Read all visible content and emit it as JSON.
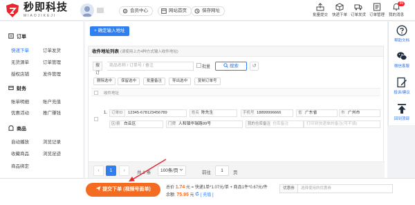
{
  "header": {
    "brand_title": "秒即科技",
    "brand_subtitle": "MIAOJIKEJI",
    "nav": [
      "会员中心",
      "网站首页",
      "保存网址"
    ],
    "icons": [
      {
        "label": "批量提交",
        "icon": "upload-icon"
      },
      {
        "label": "快递下单",
        "icon": "package-icon"
      },
      {
        "label": "订单发货",
        "icon": "truck-icon"
      },
      {
        "label": "订单管理",
        "icon": "list-icon"
      },
      {
        "label": "我的消息",
        "icon": "bell-icon",
        "badge": "99"
      }
    ]
  },
  "sidebar": {
    "groups": [
      {
        "title": "订单",
        "icon": "order-icon",
        "items": [
          "快递下单",
          "订单发货",
          "无货源单",
          "订单管理",
          "授权店铺",
          "发件管理"
        ]
      },
      {
        "title": "财务",
        "icon": "finance-icon",
        "items": [
          "账单明细",
          "账户充值",
          "优惠活动",
          "推广赚钱"
        ]
      },
      {
        "title": "商品",
        "icon": "goods-icon",
        "items": [
          "自动播放",
          "浏览记录",
          "收藏商品",
          "浏览足迹",
          "商品绑定"
        ]
      }
    ],
    "active": "快递下单"
  },
  "content": {
    "confirm_button": "+ 确定输入地址",
    "list_title": "收件地址列表",
    "list_hint": "(请使用上方4种方式输入收件地址)",
    "search": {
      "label": "搜订单",
      "placeholder": "商品名称 / 订单号 / 备注",
      "checkbox_label": "批量",
      "button": "搜索",
      "reset": "↺"
    },
    "actions": [
      "删除选中",
      "保留选中",
      "批量备注",
      "导出选中",
      "复制订单号"
    ],
    "table_header": "收件地址",
    "row": {
      "index": "1.",
      "order_label": "订单ID",
      "order_value": "12345-678123456789",
      "name_label": "姓名",
      "name_value": "陈先生",
      "phone_label": "手机号",
      "phone_value": "18899996666",
      "province_label": "省",
      "province_value": "广东省",
      "city_label": "市",
      "city_value": "广州市",
      "district_label": "区/县",
      "district_value": "白云区",
      "street_label": "门牌",
      "street_value": "人和镇华瑞路99号",
      "remark_label": "我的仓库备注",
      "remark_placeholder": "仓库备注",
      "print_placeholder": "打印到快递单的备注(可不填)"
    },
    "pagination": {
      "prev": "‹",
      "current": "1",
      "next": "›",
      "total": "共 1 条",
      "page_size": "100条/页",
      "goto_label": "前往",
      "goto_value": "1",
      "page_unit": "页"
    }
  },
  "right_bar": [
    {
      "label": "帮助文档",
      "icon": "help-icon"
    },
    {
      "label": "微信客服",
      "icon": "wechat-icon"
    },
    {
      "label": "投诉/建议",
      "icon": "feedback-icon"
    },
    {
      "label": "回到顶部",
      "icon": "top-icon"
    }
  ],
  "bottom": {
    "submit": "提交下单 (视频号面单)",
    "total_label": "总价",
    "total_value": "1.74",
    "total_detail": "元 = 快递1单*1.07元/单 + 商品1件*0.67元/件",
    "balance_label": "余额:",
    "balance_value": "75.95",
    "balance_unit": "元",
    "recharge": "[ 充值 ]",
    "coupon_label": "优惠券",
    "coupon_placeholder": "选择使用的优惠券"
  },
  "colors": {
    "primary": "#2f7ff0",
    "submit": "#f36c21",
    "brand_red": "#e8262d"
  }
}
